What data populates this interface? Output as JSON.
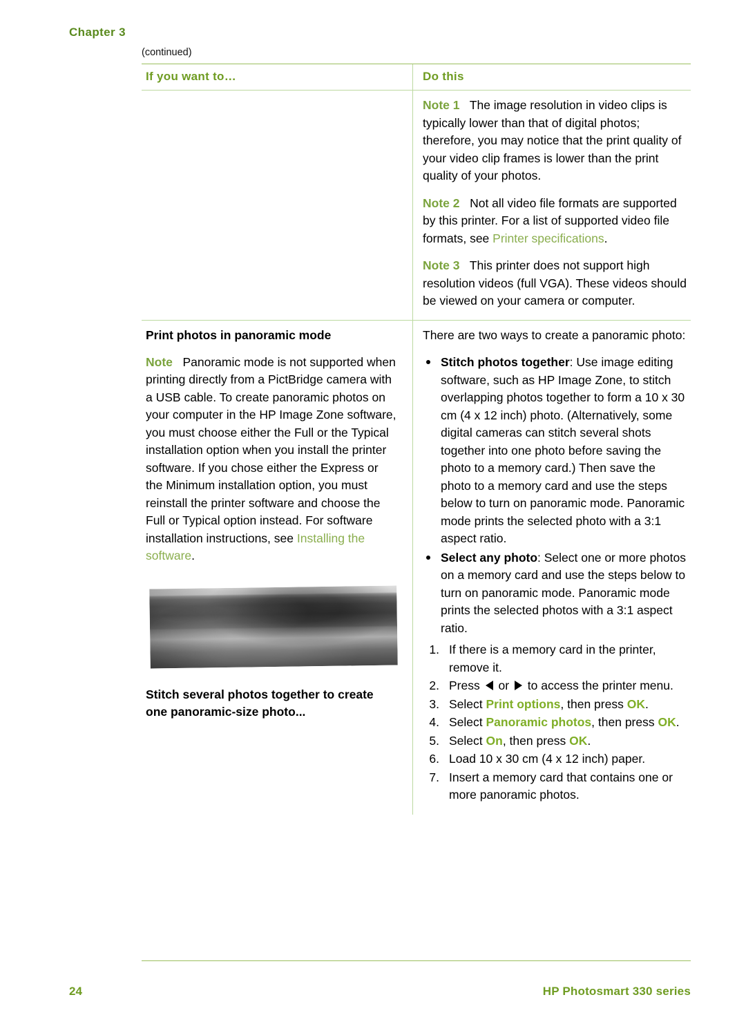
{
  "header": {
    "chapter": "Chapter 3",
    "continued": "(continued)"
  },
  "table": {
    "col1_header": "If you want to…",
    "col2_header": "Do this"
  },
  "row1": {
    "note1_label": "Note 1",
    "note1_text": "The image resolution in video clips is typically lower than that of digital photos; therefore, you may notice that the print quality of your video clip frames is lower than the print quality of your photos.",
    "note2_label": "Note 2",
    "note2_text": "Not all video file formats are supported by this printer. For a list of supported video file formats, see ",
    "note2_link": "Printer specifications",
    "note2_end": ".",
    "note3_label": "Note 3",
    "note3_text": "This printer does not support high resolution videos (full VGA). These videos should be viewed on your camera or computer."
  },
  "row2": {
    "left_title": "Print photos in panoramic mode",
    "note_label": "Note",
    "note_text": "Panoramic mode is not supported when printing directly from a PictBridge camera with a USB cable. To create panoramic photos on your computer in the HP Image Zone software, you must choose either the Full or the Typical installation option when you install the printer software. If you chose either the Express or the Minimum installation option, you must reinstall the printer software and choose the Full or Typical option instead. For software installation instructions, see ",
    "note_link": "Installing the software",
    "note_end": ".",
    "image_alt": "panoramic-photo-landscape",
    "caption": "Stitch several photos together to create one panoramic-size photo...",
    "intro": "There are two ways to create a panoramic photo:",
    "bullets": [
      {
        "bold": "Stitch photos together",
        "rest": ": Use image editing software, such as HP Image Zone, to stitch overlapping photos together to form a 10 x 30 cm (4 x 12 inch) photo. (Alternatively, some digital cameras can stitch several shots together into one photo before saving the photo to a memory card.) Then save the photo to a memory card and use the steps below to turn on panoramic mode. Panoramic mode prints the selected photo with a 3:1 aspect ratio."
      },
      {
        "bold": "Select any photo",
        "rest": ": Select one or more photos on a memory card and use the steps below to turn on panoramic mode. Panoramic mode prints the selected photos with a 3:1 aspect ratio."
      }
    ],
    "steps": [
      {
        "num": "1.",
        "text": "If there is a memory card in the printer, remove it."
      },
      {
        "num": "2.",
        "pre": "Press ",
        "mid": " or ",
        "post": " to access the printer menu."
      },
      {
        "num": "3.",
        "pre": "Select ",
        "g1": "Print options",
        "mid": ", then press ",
        "g2": "OK",
        "post": "."
      },
      {
        "num": "4.",
        "pre": "Select ",
        "g1": "Panoramic photos",
        "mid": ", then press ",
        "g2": "OK",
        "post": "."
      },
      {
        "num": "5.",
        "pre": "Select ",
        "g1": "On",
        "mid": ", then press ",
        "g2": "OK",
        "post": "."
      },
      {
        "num": "6.",
        "text": "Load 10 x 30 cm (4 x 12 inch) paper."
      },
      {
        "num": "7.",
        "text": "Insert a memory card that contains one or more panoramic photos."
      }
    ]
  },
  "footer": {
    "page_number": "24",
    "product": "HP Photosmart 330 series"
  },
  "colors": {
    "accent_green": "#6f9c22",
    "link_green": "#8aae4e",
    "rule_green": "#9bbf5e"
  }
}
